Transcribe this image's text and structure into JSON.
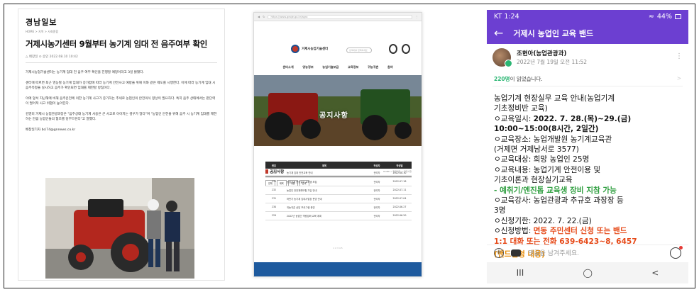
{
  "newspaper": {
    "logo": "경남일보",
    "breadcrumb": "HOME > 지역 > 사회종합",
    "headline": "거제시농기센터 9월부터 농기계 임대 전 음주여부 확인",
    "meta": "△ 배창일    ⊙ 승인 2022.08.10 10:42",
    "paragraphs": [
      "거제시농업기술센터는 농기계 임대 전 음주 여부 확인을 진행할 예정이라고 3일 밝혔다.",
      "센터에 따르면 최근 영농철 농기계 임대가 증가함에 따라 농기계 안전사고 예방을 위해 이와 같은 제도를 시행한다. 이에 따라 농기계 임대 시 음주측정을 실시하고 음주가 확인되면 임대를 제한할 방침이다.",
      "이에 앞서 지난해에 비해 음주운전에 의한 농기계 사고가 증가하는 추세로 농업인의 안전의식 향상이 필요하다. 특히 음주 상태에서는 판단력이 떨어져 사고 위험이 높아진다.",
      "김영미 거제시 농업관광과장은 \"음주상태 농기계 사용은 큰 사고로 이어지는 경우가 많다\"며 \"농업인 안전을 위해 음주 시 농기계 임대를 제한하는 만큼 농업인들의 협조를 당부드린다\"고 말했다.",
      "배창일기자 bci74@gnnews.co.kr"
    ]
  },
  "website": {
    "url": "https://www.geoje.go.kr/agro",
    "site_name": "거제시농업기술센터",
    "search_placeholder": "검색어를 입력하세요",
    "nav": [
      "센터소개",
      "영농정보",
      "농업기술보급",
      "교육정보",
      "귀농귀촌",
      "참여"
    ],
    "hero_title": "공지사항",
    "section_title": "공지사항",
    "location": "HOME > 알림마당 > 공지사항",
    "search_buttons": [
      "전체",
      "제목",
      "내용",
      "검색"
    ],
    "table_headers": [
      "번호",
      "제목",
      "작성자",
      "작성일"
    ],
    "rows": [
      {
        "no": "234",
        "title": "농기계 임대 안전교육 안내",
        "writer": "관리자",
        "date": "2022.08.10"
      },
      {
        "no": "233",
        "title": "농업기계 현장실무 교육생 모집",
        "writer": "관리자",
        "date": "2022.07.18"
      },
      {
        "no": "232",
        "title": "농업인 안전재해보험 가입 안내",
        "writer": "관리자",
        "date": "2022.07.11"
      },
      {
        "no": "231",
        "title": "하반기 농기계 임대사업장 운영 안내",
        "writer": "관리자",
        "date": "2022.07.04"
      },
      {
        "no": "230",
        "title": "귀농귀촌 상담 프로그램 운영",
        "writer": "관리자",
        "date": "2022.06.27"
      },
      {
        "no": "229",
        "title": "2022년 농업인 역량강화 교육 계획",
        "writer": "관리자",
        "date": "2022.06.20"
      }
    ],
    "pager": "1  2  3  4  5"
  },
  "phone": {
    "status_time": "KT 1:24",
    "status_right": "44%",
    "band_name": "거제시 농업인 교육 밴드",
    "author_name": "조현아(농업관광과)",
    "author_date": "2022년 7월 19일 오전 11:52",
    "readers_count": "220명",
    "readers_suffix": "이 읽었습니다.",
    "post": {
      "line1": "농업기계 현장실무 교육 안내(농업기계",
      "line2": "기초정비반 교육)",
      "date_label": "ㅇ교육일시: ",
      "date_value": "2022. 7. 28.(목)~29.(금)",
      "time_value": "10:00~15:00(8시간, 2일간)",
      "place": "ㅇ교육장소: 농업개발원 농기계교육관",
      "address": "(거제면 거제남서로 3577)",
      "target": "ㅇ교육대상: 희망 농업인 25명",
      "content": "ㅇ교육내용: 농업기계 안전이용 및",
      "content2": "기초이론과 현장실기교육",
      "green_note": " - 예취기/엔진톱 교육생 장비 지참 가능",
      "teacher": "ㅇ교육강사: 농업관광과 추규호 과장장 등",
      "teacher2": "3명",
      "deadline": "ㅇ신청기한: 2022. 7. 22.(금)",
      "method_label": "ㅇ신청방법: ",
      "method_red": "면동 주민센터 신청 또는 밴드",
      "method_red2": "1:1 대화 또는 전화 639-6423~8, 6457",
      "band_apply": "(밴드신청 내용)"
    },
    "comment_placeholder": "댓글을 남겨주세요.",
    "nav_buttons": [
      "III",
      "◯",
      "<"
    ]
  },
  "colors": {
    "band_purple": "#6c3fd1",
    "accent_red": "#e64a19",
    "accent_green": "#2e9e3f",
    "accent_orange": "#e88a00",
    "site_footer_blue": "#1e5a9e"
  }
}
